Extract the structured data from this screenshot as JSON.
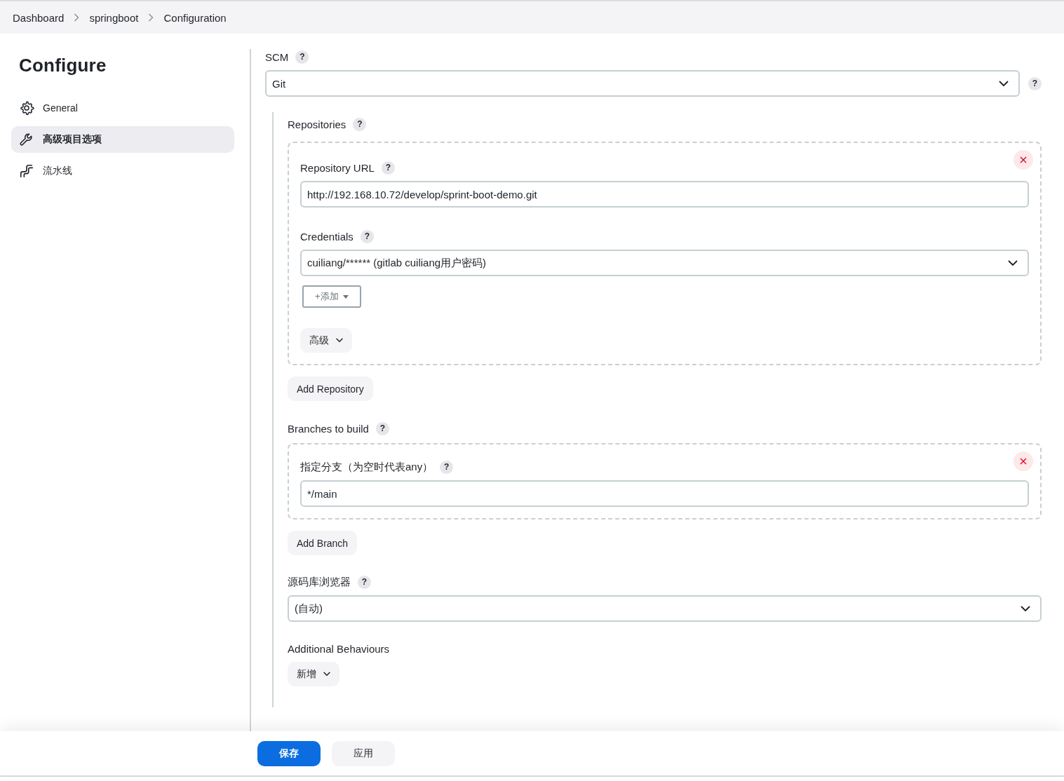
{
  "breadcrumbs": [
    {
      "label": "Dashboard"
    },
    {
      "label": "springboot"
    },
    {
      "label": "Configuration"
    }
  ],
  "sidebar": {
    "title": "Configure",
    "items": [
      {
        "label": "General",
        "kind": "gear",
        "selected": false
      },
      {
        "label": "高级项目选项",
        "kind": "wrench",
        "selected": true
      },
      {
        "label": "流水线",
        "kind": "pipeline",
        "selected": false
      }
    ]
  },
  "scm": {
    "label": "SCM",
    "help": "?",
    "value": "Git",
    "side_help": "?"
  },
  "repositories": {
    "label": "Repositories",
    "help": "?",
    "items": [
      {
        "url_label": "Repository URL",
        "url_help": "?",
        "url": "http://192.168.10.72/develop/sprint-boot-demo.git",
        "credentials_label": "Credentials",
        "credentials_help": "?",
        "credentials": "cuiliang/****** (gitlab cuiliang用户密码)",
        "add_button": "+添加",
        "advanced_button": "高级"
      }
    ]
  },
  "add_repository": "Add Repository",
  "branches": {
    "label": "Branches to build",
    "help": "?",
    "items": [
      {
        "label": "指定分支（为空时代表any）",
        "help": "?",
        "value": "*/main"
      }
    ]
  },
  "add_branch": "Add Branch",
  "repo_browser": {
    "label": "源码库浏览器",
    "help": "?",
    "value": "(自动)"
  },
  "behaviours": {
    "label": "Additional Behaviours",
    "button": "新增"
  },
  "footer": {
    "buttons": [
      {
        "label": "保存",
        "kind": "primary"
      },
      {
        "label": "应用",
        "kind": "secondary"
      }
    ]
  }
}
